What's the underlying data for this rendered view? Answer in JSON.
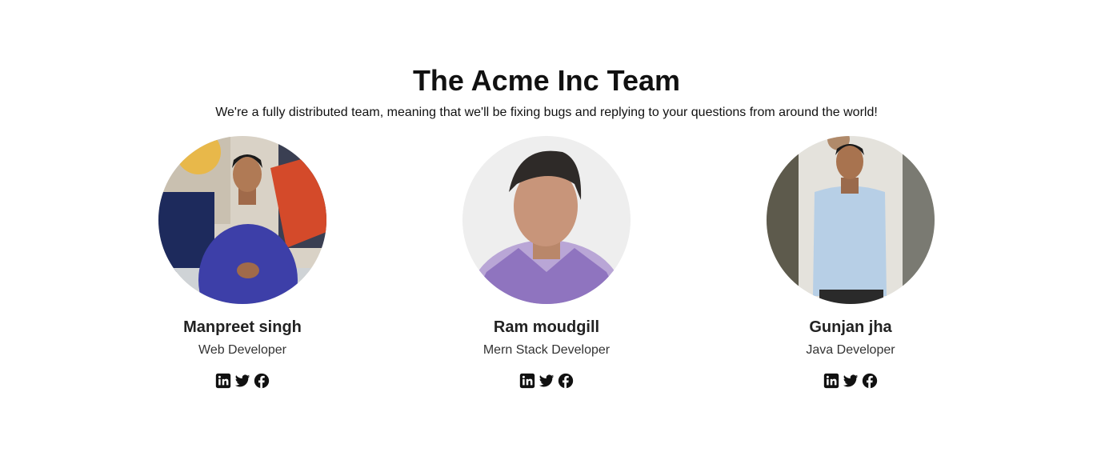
{
  "header": {
    "title": "The Acme Inc Team",
    "subtitle": "We're a fully distributed team, meaning that we'll be fixing bugs and replying to your questions from around the world!"
  },
  "members": [
    {
      "name": "Manpreet singh",
      "role": "Web Developer",
      "social": [
        "linkedin-icon",
        "twitter-icon",
        "facebook-icon"
      ]
    },
    {
      "name": "Ram moudgill",
      "role": "Mern Stack Developer",
      "social": [
        "linkedin-icon",
        "twitter-icon",
        "facebook-icon"
      ]
    },
    {
      "name": "Gunjan jha",
      "role": "Java Developer",
      "social": [
        "linkedin-icon",
        "twitter-icon",
        "facebook-icon"
      ]
    }
  ],
  "colors": {
    "text": "#111111",
    "icon": "#111111",
    "background": "#ffffff"
  }
}
